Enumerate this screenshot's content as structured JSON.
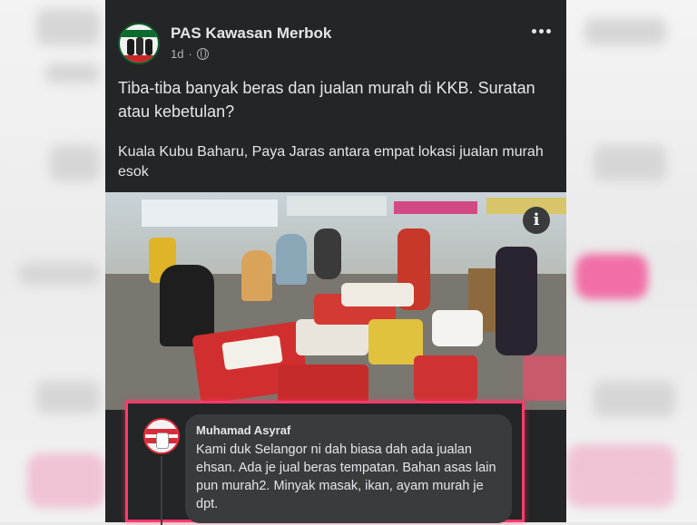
{
  "post": {
    "page_name": "PAS Kawasan Merbok",
    "time": "1d",
    "text": "Tiba-tiba banyak beras dan jualan murah di KKB. Suratan atau kebetulan?",
    "link_title": "Kuala Kubu Baharu, Paya Jaras antara empat lokasi jualan murah esok",
    "icons": {
      "more": "more-options-icon",
      "privacy": "globe-icon",
      "info": "info-icon"
    }
  },
  "comment": {
    "author": "Muhamad Asyraf",
    "text": "Kami duk Selangor ni dah biasa dah ada jualan ehsan. Ada je jual beras tempatan. Bahan asas lain pun murah2. Minyak masak, ikan, ayam murah je dpt."
  },
  "colors": {
    "card_bg": "#242526",
    "bubble_bg": "#3a3b3c",
    "highlight": "#ff3b6b",
    "text": "#e4e6eb",
    "meta": "#b0b3b8"
  }
}
